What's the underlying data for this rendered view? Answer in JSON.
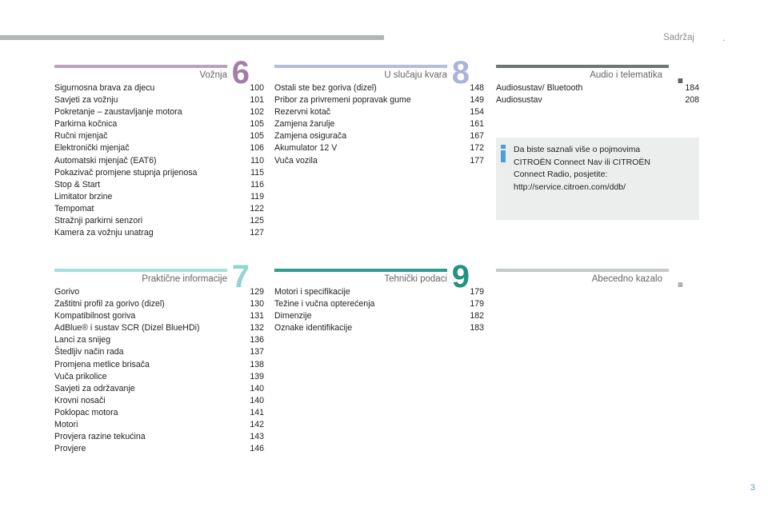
{
  "header": {
    "label": "Sadržaj",
    "dot": "."
  },
  "sections": {
    "s6": {
      "title": "Vožnja",
      "number": "6",
      "bar_color": "#b9a3b9",
      "num_color": "#a27ea2",
      "entries": [
        {
          "label": "Sigurnosna brava za djecu",
          "page": "100"
        },
        {
          "label": "Savjeti za vožnju",
          "page": "101"
        },
        {
          "label": "Pokretanje – zaustavljanje motora",
          "page": "102"
        },
        {
          "label": "Parkirna kočnica",
          "page": "105"
        },
        {
          "label": "Ručni mjenjač",
          "page": "105"
        },
        {
          "label": "Elektronički mjenjač",
          "page": "106"
        },
        {
          "label": "Automatski mjenjač (EAT6)",
          "page": "110"
        },
        {
          "label": "Pokazivač promjene stupnja prijenosa",
          "page": "115"
        },
        {
          "label": "Stop & Start",
          "page": "116"
        },
        {
          "label": "Limitator brzine",
          "page": "119"
        },
        {
          "label": "Tempomat",
          "page": "122"
        },
        {
          "label": "Stražnji parkirni senzori",
          "page": "125"
        },
        {
          "label": "Kamera za vožnju unatrag",
          "page": "127"
        }
      ]
    },
    "s8": {
      "title": "U slučaju kvara",
      "number": "8",
      "bar_color": "#b6bdda",
      "num_color": "#aab3d8",
      "entries": [
        {
          "label": "Ostali ste bez goriva (dizel)",
          "page": "148"
        },
        {
          "label": "Pribor za privremeni popravak gume",
          "page": "149"
        },
        {
          "label": "Rezervni kotač",
          "page": "154"
        },
        {
          "label": "Zamjena žarulje",
          "page": "161"
        },
        {
          "label": "Zamjena osigurača",
          "page": "167"
        },
        {
          "label": "Akumulator 12 V",
          "page": "172"
        },
        {
          "label": "Vuča vozila",
          "page": "177"
        }
      ]
    },
    "saudio": {
      "title": "Audio i telematika",
      "number": ".",
      "bar_color": "#6f7574",
      "num_color": "#5b6261",
      "entries": [
        {
          "label": "Audiosustav/ Bluetooth",
          "page": "184"
        },
        {
          "label": "Audiosustav",
          "page": "208"
        }
      ]
    },
    "s7": {
      "title": "Praktične informacije",
      "number": "7",
      "bar_color": "#a5e0dc",
      "num_color": "#8dd6d1",
      "entries": [
        {
          "label": "Gorivo",
          "page": "129"
        },
        {
          "label": "Zaštitni profil za gorivo (dizel)",
          "page": "130"
        },
        {
          "label": "Kompatibilnost goriva",
          "page": "131"
        },
        {
          "label": "AdBlue® i sustav SCR (Dizel BlueHDi)",
          "page": "132"
        },
        {
          "label": "Lanci za snijeg",
          "page": "136"
        },
        {
          "label": "Štedljiv način rada",
          "page": "137"
        },
        {
          "label": "Promjena metlice brisača",
          "page": "138"
        },
        {
          "label": "Vuča prikolice",
          "page": "139"
        },
        {
          "label": "Savjeti za održavanje",
          "page": "140"
        },
        {
          "label": "Krovni nosači",
          "page": "140"
        },
        {
          "label": "Poklopac motora",
          "page": "141"
        },
        {
          "label": "Motori",
          "page": "142"
        },
        {
          "label": "Provjera razine tekućina",
          "page": "143"
        },
        {
          "label": "Provjere",
          "page": "146"
        }
      ]
    },
    "s9": {
      "title": "Tehnički podaci",
      "number": "9",
      "bar_color": "#2e9c8e",
      "num_color": "#23927f",
      "entries": [
        {
          "label": "Motori i specifikacije",
          "page": "179"
        },
        {
          "label": "Težine i vučna opterećenja",
          "page": "179"
        },
        {
          "label": "Dimenzije",
          "page": "182"
        },
        {
          "label": "Oznake identifikacije",
          "page": "183"
        }
      ]
    },
    "sindex": {
      "title": "Abecedno kazalo",
      "number": ".",
      "bar_color": "#c6cac9",
      "num_color": "#aeb3b2",
      "entries": []
    }
  },
  "info_box": {
    "text_lines": [
      "Da biste saznali više o pojmovima",
      "CITROËN Connect Nav ili CITROËN",
      "Connect Radio, posjetite:",
      "http://service.citroen.com/ddb/"
    ],
    "icon": "info-icon",
    "icon_color": "#4a9fd8"
  },
  "page_number": "3"
}
